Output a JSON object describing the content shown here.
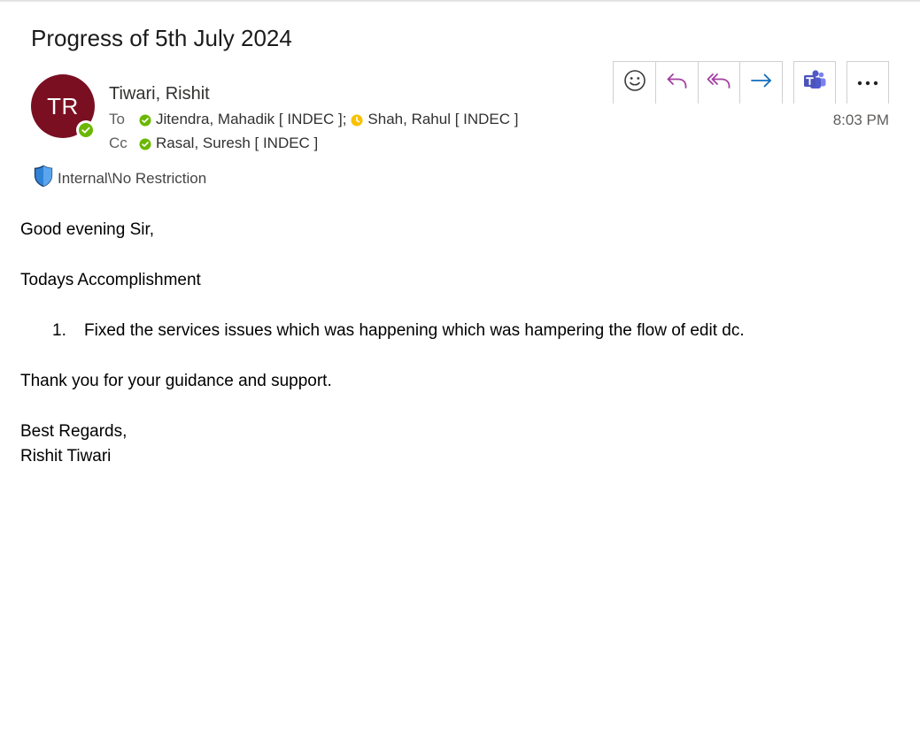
{
  "email": {
    "subject": "Progress of 5th July 2024",
    "sender": {
      "initials": "TR",
      "name": "Tiwari, Rishit",
      "avatar_color": "#7a0f22",
      "presence": "available"
    },
    "to_label": "To",
    "cc_label": "Cc",
    "to": [
      {
        "name": "Jitendra, Mahadik [ INDEC ];",
        "presence": "available",
        "presence_color": "#6bb700"
      },
      {
        "name": "Shah, Rahul [ INDEC ]",
        "presence": "away",
        "presence_color": "#f8c200"
      }
    ],
    "cc": [
      {
        "name": "Rasal, Suresh [ INDEC ]",
        "presence": "available",
        "presence_color": "#6bb700"
      }
    ],
    "classification": "Internal\\No Restriction",
    "time": "8:03 PM"
  },
  "toolbar": {
    "react_icon": "smiley-icon",
    "reply_icon": "reply-icon",
    "reply_all_icon": "reply-all-icon",
    "forward_icon": "forward-icon",
    "teams_icon": "teams-icon",
    "more_icon": "more-icon",
    "accent_purple": "#a33ea1",
    "accent_blue": "#0f6cbd"
  },
  "body": {
    "greeting": "Good evening Sir,",
    "heading": "Todays Accomplishment",
    "items": [
      {
        "number": "1.",
        "text": "Fixed the services issues which was happening which was hampering the flow of edit dc."
      }
    ],
    "thanks": "Thank you for your guidance and support.",
    "closing": "Best Regards,",
    "signature": "Rishit Tiwari"
  }
}
